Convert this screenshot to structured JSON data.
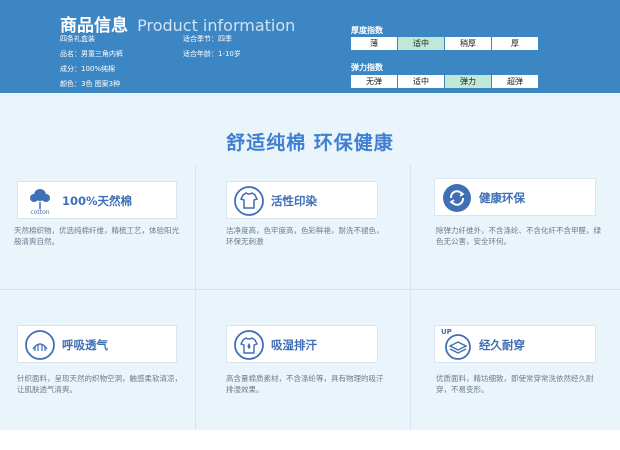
{
  "header": {
    "title_cn": "商品信息",
    "title_en": "Product information",
    "specs": {
      "name": "四条礼盒装",
      "season": "适合季节：四季",
      "product": "品名：男童三角内裤",
      "age": "适合年龄：1-10岁",
      "material": "成分：100%纯棉",
      "colors": "颜色：3色  图案3种"
    },
    "thickness": {
      "label": "厚度指数",
      "options": [
        "薄",
        "适中",
        "稍厚",
        "厚"
      ],
      "selected": "适中"
    },
    "elasticity": {
      "label": "弹力指数",
      "options": [
        "无弹",
        "适中",
        "弹力",
        "超弹"
      ],
      "selected": "弹力"
    }
  },
  "headline": "舒适纯棉  环保健康",
  "features": [
    {
      "title": "100%天然棉",
      "icon": "cotton-icon",
      "icon_caption": "cotton",
      "desc": "天然棉织物，优选纯棉纤维，精梳工艺，体验阳光般清爽自然。"
    },
    {
      "title": "活性印染",
      "icon": "tshirt-icon",
      "desc": "洁净度高，色牢度高，色彩鲜艳，耐洗不褪色，环保无刺激"
    },
    {
      "title": "健康环保",
      "icon": "recycle-icon",
      "desc": "除弹力纤维外，不含涤纶、不含化纤不含甲醛，绿色无公害，安全环何。"
    },
    {
      "title": "呼吸透气",
      "icon": "breathable-icon",
      "desc": "针织面料，呈现天然的织物空洞，触感柔软清凉，让肌肤透气清爽。"
    },
    {
      "title": "吸湿排汗",
      "icon": "moisture-icon",
      "desc": "高含量棉质素材，不含涤纶等，具有物理的吸汗排湿效果。"
    },
    {
      "title": "经久耐穿",
      "icon": "layers-icon",
      "icon_caption": "UP",
      "desc": "优质面料，精坊细致，即使常穿常洗依然经久耐穿，不易变形。"
    }
  ],
  "colors": {
    "header_bg": "#3d86c4",
    "accent": "#3f7fd0",
    "active_cell": "#bfe8d6",
    "panel_bg": "#eaf4fb"
  }
}
